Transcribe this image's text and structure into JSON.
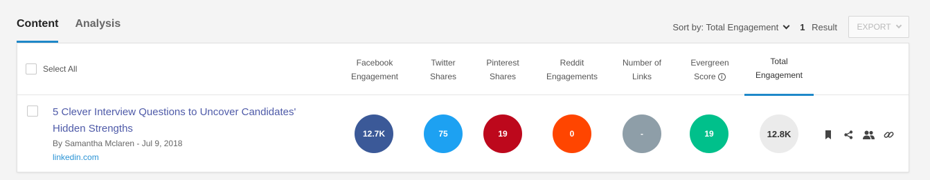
{
  "tabs": [
    {
      "label": "Content",
      "active": true
    },
    {
      "label": "Analysis",
      "active": false
    }
  ],
  "controls": {
    "sort_label": "Sort by: Total Engagement",
    "result_count": "1",
    "result_label": "Result",
    "export_label": "EXPORT"
  },
  "table": {
    "select_all": "Select All",
    "columns": [
      {
        "line1": "Facebook",
        "line2": "Engagement"
      },
      {
        "line1": "Twitter",
        "line2": "Shares"
      },
      {
        "line1": "Pinterest",
        "line2": "Shares"
      },
      {
        "line1": "Reddit",
        "line2": "Engagements"
      },
      {
        "line1": "Number of",
        "line2": "Links"
      },
      {
        "line1": "Evergreen",
        "line2": "Score"
      },
      {
        "line1": "Total",
        "line2": "Engagement"
      }
    ],
    "rows": [
      {
        "title_line1": "5 Clever Interview Questions to Uncover Candidates'",
        "title_line2": "Hidden Strengths",
        "byline": "By Samantha Mclaren - Jul 9, 2018",
        "domain": "linkedin.com",
        "metrics": [
          "12.7K",
          "75",
          "19",
          "0",
          "-",
          "19",
          "12.8K"
        ]
      }
    ]
  },
  "colors": {
    "accent": "#1e88c9",
    "facebook": "#3b5998",
    "twitter": "#1da1f2",
    "pinterest": "#bd081c",
    "reddit": "#ff4500",
    "links": "#8e9ea8",
    "evergreen": "#00c08b",
    "total": "#ebebeb"
  },
  "icons": [
    "chevron-down-icon",
    "info-icon",
    "bookmark-icon",
    "share-icon",
    "users-icon",
    "link-icon"
  ]
}
